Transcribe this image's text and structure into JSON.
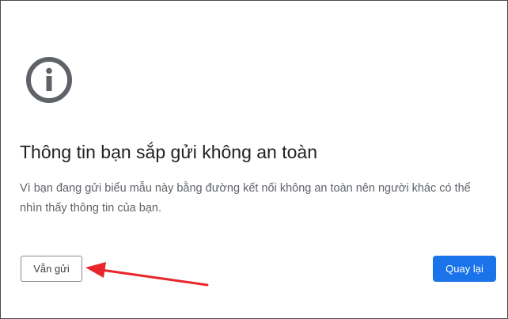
{
  "page": {
    "icon": "info-circle-icon",
    "title": "Thông tin bạn sắp gửi không an toàn",
    "description": "Vì bạn đang gửi biểu mẫu này bằng đường kết nối không an toàn nên người khác có thể nhìn thấy thông tin của bạn."
  },
  "buttons": {
    "proceed_label": "Vẫn gửi",
    "back_label": "Quay lại"
  },
  "annotation": {
    "icon": "red-arrow-icon",
    "color": "#e8252a"
  },
  "colors": {
    "primary": "#1a73e8",
    "icon": "#5f6368"
  }
}
